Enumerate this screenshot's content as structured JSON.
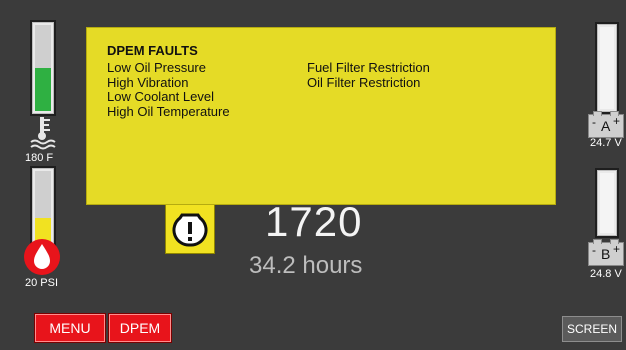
{
  "gauges": {
    "coolant": {
      "level": 0.5,
      "fill_color": "#2fb042",
      "value_label": "180 F",
      "icon": "coolant-temperature-icon"
    },
    "oil_pressure": {
      "level": 0.45,
      "fill_color": "#f1e221",
      "value_label": "20 PSI",
      "icon": "oil-drop-icon"
    },
    "battery_a": {
      "level": 1.0,
      "fill_color": "#f4f4f4",
      "letter": "A",
      "minus": "-",
      "plus": "+",
      "value_label": "24.7 V",
      "icon": "battery-icon"
    },
    "battery_b": {
      "level": 1.0,
      "fill_color": "#f4f4f4",
      "letter": "B",
      "minus": "-",
      "plus": "+",
      "value_label": "24.8 V",
      "icon": "battery-icon"
    }
  },
  "faults": {
    "title": "DPEM FAULTS",
    "left": [
      "Low Oil Pressure",
      "High Vibration",
      "Low Coolant Level",
      "High Oil Temperature"
    ],
    "right": [
      "Fuel Filter Restriction",
      "Oil Filter Restriction"
    ],
    "background": "#e5db26"
  },
  "engine": {
    "rpm": "1720",
    "hours": "34.2 hours",
    "warning_icon": "engine-warning-icon"
  },
  "buttons": {
    "menu": "MENU",
    "dpem": "DPEM",
    "screen": "SCREEN"
  },
  "colors": {
    "background": "#3b3b3b",
    "button_red": "#e8141b",
    "warning_yellow": "#f1e221"
  }
}
